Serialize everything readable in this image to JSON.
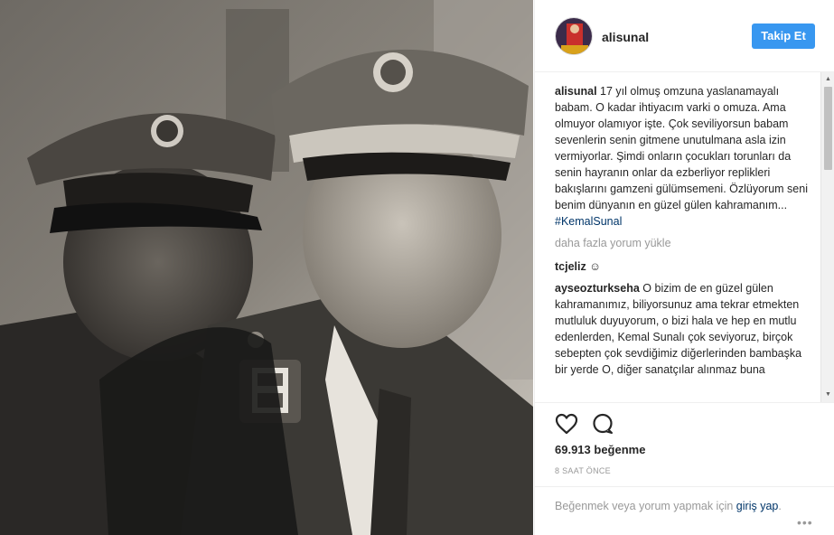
{
  "post": {
    "username": "alisunal",
    "follow_label": "Takip Et",
    "caption_username": "alisunal",
    "caption_text": "17 yıl olmuş omzuna yaslanamayalı babam. O kadar ihtiyacım varki o omuza. Ama olmuyor olamıyor işte. Çok seviliyorsun babam sevenlerin senin gitmene unutulmana asla izin vermiyorlar. Şimdi onların çocukları torunları da senin hayranın onlar da ezberliyor replikleri bakışlarını gamzeni gülümsemeni. Özlüyorum seni benim dünyanın en güzel gülen kahramanım...",
    "caption_hashtag": "#KemalSunal",
    "load_more_label": "daha fazla yorum yükle",
    "comments": [
      {
        "user": "tcjeliz",
        "text": "☺"
      },
      {
        "user": "ayseozturkseha",
        "text": "O bizim de en güzel gülen kahramanımız, biliyorsunuz ama tekrar etmekten mutluluk duyuyorum, o bizi hala ve hep en mutlu edenlerden, Kemal Sunalı çok seviyoruz, birçok sebepten çok sevdiğimiz diğerlerinden bambaşka bir yerde O, diğer sanatçılar alınmaz buna"
      }
    ],
    "likes_label": "69.913 beğenme",
    "time_label": "8 SAAT ÖNCE",
    "login_prompt": "Beğenmek veya yorum yapmak için",
    "login_link": "giriş yap",
    "login_suffix": ".",
    "more_label": "•••"
  },
  "icons": {
    "like": "heart-icon",
    "comment": "comment-icon",
    "more": "more-options-icon"
  },
  "colors": {
    "follow_button": "#3897f0",
    "hashtag": "#003569",
    "muted": "#999999"
  }
}
